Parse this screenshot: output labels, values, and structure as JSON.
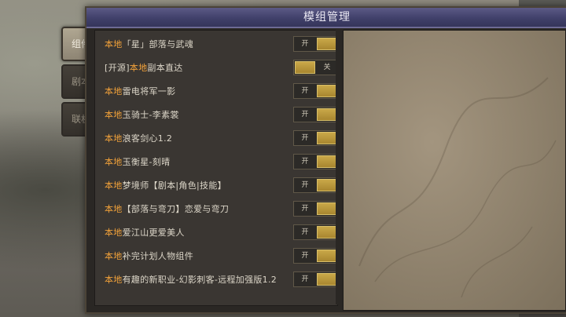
{
  "window": {
    "title": "模组管理"
  },
  "tabs": [
    {
      "label": "组件",
      "active": true
    },
    {
      "label": "剧本",
      "active": false
    },
    {
      "label": "联机",
      "active": false
    }
  ],
  "mods": [
    {
      "prefix": "",
      "local": "本地",
      "name": "「星」部落与武魂",
      "state": "开",
      "on": true
    },
    {
      "prefix": "[开源]",
      "local": "本地",
      "name": "副本直达",
      "state": "关",
      "on": false
    },
    {
      "prefix": "",
      "local": "本地",
      "name": "雷电将军一影",
      "state": "开",
      "on": true
    },
    {
      "prefix": "",
      "local": "本地",
      "name": "玉骑士-李素裳",
      "state": "开",
      "on": true
    },
    {
      "prefix": "",
      "local": "本地",
      "name": "浪客剑心1.2",
      "state": "开",
      "on": true
    },
    {
      "prefix": "",
      "local": "本地",
      "name": "玉衡星-刻晴",
      "state": "开",
      "on": true
    },
    {
      "prefix": "",
      "local": "本地",
      "name": "梦境师【剧本|角色|技能】",
      "state": "开",
      "on": true
    },
    {
      "prefix": "",
      "local": "本地",
      "name": "【部落与弯刀】恋爱与弯刀",
      "state": "开",
      "on": true
    },
    {
      "prefix": "",
      "local": "本地",
      "name": "爱江山更爱美人",
      "state": "开",
      "on": true
    },
    {
      "prefix": "",
      "local": "本地",
      "name": "补完计划人物组件",
      "state": "开",
      "on": true
    },
    {
      "prefix": "",
      "local": "本地",
      "name": "有趣的新职业-幻影刺客-远程加强版1.2",
      "state": "开",
      "on": true
    }
  ],
  "colors": {
    "local_tag": "#f2a23a",
    "toggle_knob": "#c9a849",
    "title_bar": "#40406a"
  }
}
